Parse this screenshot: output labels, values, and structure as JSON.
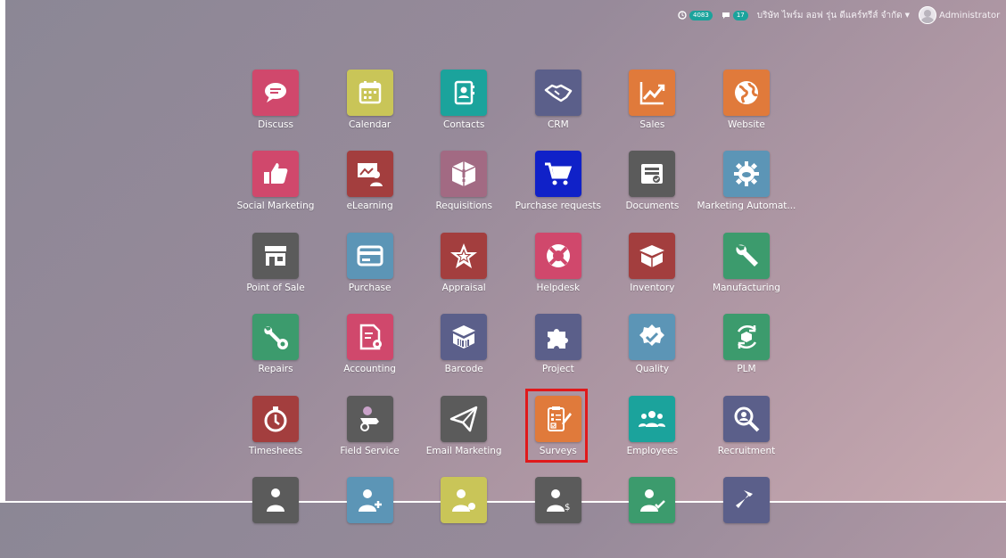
{
  "topbar": {
    "activity_count": "4083",
    "messages_count": "17",
    "company": "บริษัท ไพร์ม ลอฟ รุ่น ดีแคร์ทรีส์ จำกัด",
    "user": "Administrator"
  },
  "apps": [
    {
      "label": "Discuss",
      "icon": "chat-bubble-icon",
      "color": "#d0486c"
    },
    {
      "label": "Calendar",
      "icon": "calendar-icon",
      "color": "#c9c558"
    },
    {
      "label": "Contacts",
      "icon": "contact-book-icon",
      "color": "#1ba39c"
    },
    {
      "label": "CRM",
      "icon": "handshake-icon",
      "color": "#5b5f8a"
    },
    {
      "label": "Sales",
      "icon": "line-chart-icon",
      "color": "#e07a3b"
    },
    {
      "label": "Website",
      "icon": "globe-icon",
      "color": "#e07a3b"
    },
    {
      "label": "Social Marketing",
      "icon": "thumbs-up-icon",
      "color": "#d0486c"
    },
    {
      "label": "eLearning",
      "icon": "presentation-icon",
      "color": "#a33e3e"
    },
    {
      "label": "Requisitions",
      "icon": "box-alert-icon",
      "color": "#a26a83"
    },
    {
      "label": "Purchase requests",
      "icon": "shopping-cart-icon",
      "color": "#1021c8"
    },
    {
      "label": "Documents",
      "icon": "inbox-tray-icon",
      "color": "#5b5b5b"
    },
    {
      "label": "Marketing Automat...",
      "icon": "gear-cloud-icon",
      "color": "#5c95b6"
    },
    {
      "label": "Point of Sale",
      "icon": "store-icon",
      "color": "#5b5b5b"
    },
    {
      "label": "Purchase",
      "icon": "credit-card-icon",
      "color": "#5c95b6"
    },
    {
      "label": "Appraisal",
      "icon": "star-icon",
      "color": "#a33e3e"
    },
    {
      "label": "Helpdesk",
      "icon": "lifebuoy-icon",
      "color": "#d0486c"
    },
    {
      "label": "Inventory",
      "icon": "open-box-icon",
      "color": "#a33e3e"
    },
    {
      "label": "Manufacturing",
      "icon": "wrench-icon",
      "color": "#3c9b6d"
    },
    {
      "label": "Repairs",
      "icon": "repair-tools-icon",
      "color": "#3c9b6d"
    },
    {
      "label": "Accounting",
      "icon": "invoice-gear-icon",
      "color": "#d0486c"
    },
    {
      "label": "Barcode",
      "icon": "barcode-box-icon",
      "color": "#5b5f8a"
    },
    {
      "label": "Project",
      "icon": "puzzle-icon",
      "color": "#5b5f8a"
    },
    {
      "label": "Quality",
      "icon": "quality-badge-icon",
      "color": "#5c95b6"
    },
    {
      "label": "PLM",
      "icon": "cycle-box-icon",
      "color": "#3c9b6d"
    },
    {
      "label": "Timesheets",
      "icon": "stopwatch-icon",
      "color": "#a33e3e"
    },
    {
      "label": "Field Service",
      "icon": "field-service-icon",
      "color": "#5b5b5b"
    },
    {
      "label": "Email Marketing",
      "icon": "paper-plane-icon",
      "color": "#5b5b5b"
    },
    {
      "label": "Surveys",
      "icon": "survey-form-icon",
      "color": "#e07a3b"
    },
    {
      "label": "Employees",
      "icon": "team-icon",
      "color": "#1ba39c"
    },
    {
      "label": "Recruitment",
      "icon": "magnifier-icon",
      "color": "#5b5f8a"
    },
    {
      "label": "",
      "icon": "person-icon",
      "color": "#5b5b5b"
    },
    {
      "label": "",
      "icon": "user-add-icon",
      "color": "#5c95b6"
    },
    {
      "label": "",
      "icon": "user-gear-icon",
      "color": "#c9c558"
    },
    {
      "label": "",
      "icon": "user-money-icon",
      "color": "#5b5b5b"
    },
    {
      "label": "",
      "icon": "user-check-icon",
      "color": "#3c9b6d"
    },
    {
      "label": "",
      "icon": "hammer-icon",
      "color": "#5b5f8a"
    }
  ],
  "highlighted_app": "Surveys"
}
